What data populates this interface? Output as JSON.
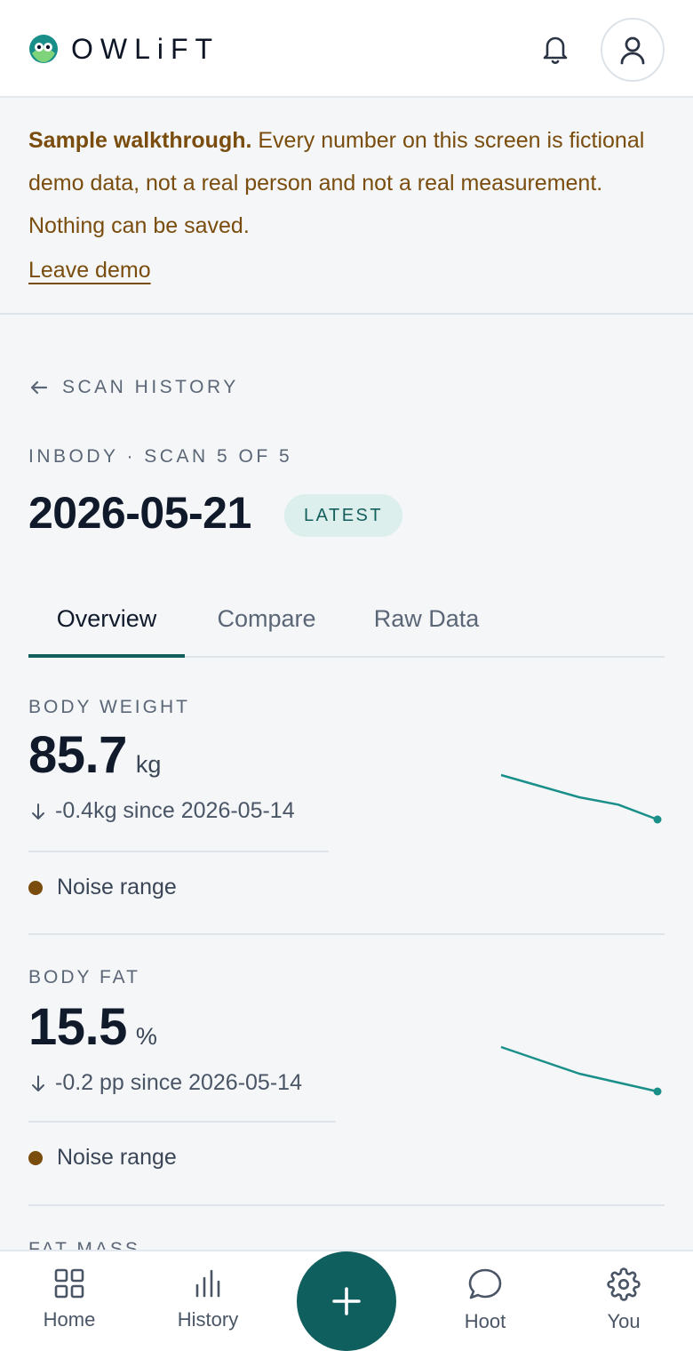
{
  "app": {
    "name": "OWLiFT"
  },
  "banner": {
    "bold": "Sample walkthrough.",
    "text": " Every number on this screen is fictional demo data, not a real person and not a real measurement. Nothing can be saved.",
    "leave_label": "Leave demo"
  },
  "page": {
    "back_label": "SCAN HISTORY",
    "subtitle": "INBODY · SCAN 5 OF 5",
    "date": "2026-05-21",
    "badge": "LATEST"
  },
  "tabs": [
    {
      "label": "Overview",
      "active": true
    },
    {
      "label": "Compare",
      "active": false
    },
    {
      "label": "Raw Data",
      "active": false
    }
  ],
  "metrics": [
    {
      "label": "BODY WEIGHT",
      "value": "85.7",
      "unit": "kg",
      "delta": "-0.4kg since 2026-05-14",
      "noise": "Noise range",
      "trend": [
        86.9,
        86.6,
        86.3,
        86.1,
        85.7
      ]
    },
    {
      "label": "BODY FAT",
      "value": "15.5",
      "unit": "%",
      "delta": "-0.2 pp since 2026-05-14",
      "noise": "Noise range",
      "trend": [
        16.5,
        16.2,
        15.9,
        15.7,
        15.5
      ]
    }
  ],
  "next_metric_label": "FAT MASS",
  "colors": {
    "accent": "#145e5b",
    "spark": "#1a8f8a",
    "warn": "#7a4d0e"
  },
  "nav": [
    {
      "label": "Home",
      "icon": "grid-icon"
    },
    {
      "label": "History",
      "icon": "bar-chart-icon"
    },
    {
      "label": "Hoot",
      "icon": "chat-bubble-icon"
    },
    {
      "label": "You",
      "icon": "gear-icon"
    }
  ],
  "fab_icon": "plus-icon"
}
